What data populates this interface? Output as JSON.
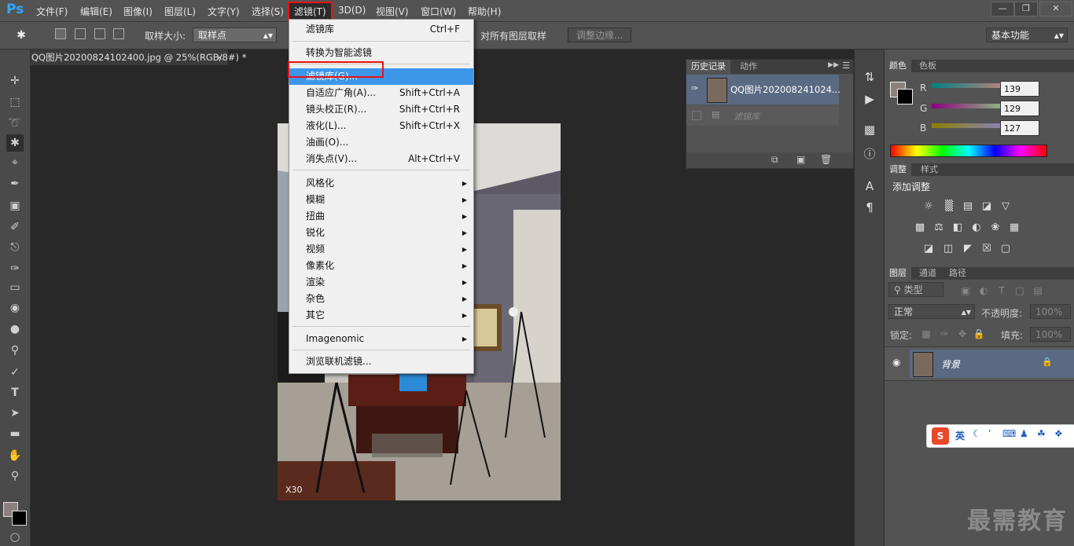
{
  "app": {
    "logo": "Ps"
  },
  "menubar": {
    "items": [
      "文件(F)",
      "编辑(E)",
      "图像(I)",
      "图层(L)",
      "文字(Y)",
      "选择(S)",
      "滤镜(T)",
      "3D(D)",
      "视图(V)",
      "窗口(W)",
      "帮助(H)"
    ]
  },
  "options": {
    "sample_size_label": "取样大小:",
    "sample_size_value": "取样点",
    "all_layers_label": "对所有图层取样",
    "refine_edge_label": "调整边缘...",
    "workspace_value": "基本功能"
  },
  "document": {
    "tab_title": "QQ图片20200824102400.jpg @ 25%(RGB/8#) *",
    "photo_caption": "X30"
  },
  "filter_menu": {
    "items": [
      {
        "label": "滤镜库",
        "shortcut": "Ctrl+F"
      },
      {
        "label": "转换为智能滤镜"
      },
      {
        "label": "滤镜库(G)..."
      },
      {
        "label": "自适应广角(A)...",
        "shortcut": "Shift+Ctrl+A"
      },
      {
        "label": "镜头校正(R)...",
        "shortcut": "Shift+Ctrl+R"
      },
      {
        "label": "液化(L)...",
        "shortcut": "Shift+Ctrl+X"
      },
      {
        "label": "油画(O)..."
      },
      {
        "label": "消失点(V)...",
        "shortcut": "Alt+Ctrl+V"
      },
      {
        "label": "风格化"
      },
      {
        "label": "模糊"
      },
      {
        "label": "扭曲"
      },
      {
        "label": "锐化"
      },
      {
        "label": "视频"
      },
      {
        "label": "像素化"
      },
      {
        "label": "渲染"
      },
      {
        "label": "杂色"
      },
      {
        "label": "其它"
      },
      {
        "label": "Imagenomic"
      },
      {
        "label": "浏览联机滤镜..."
      }
    ]
  },
  "history_panel": {
    "tabs": [
      "历史记录",
      "动作"
    ],
    "snapshot_label": "QQ图片202008241024...",
    "step_label": "滤镜库"
  },
  "color_panel": {
    "tabs": [
      "颜色",
      "色板"
    ],
    "r_label": "R",
    "g_label": "G",
    "b_label": "B",
    "r": "139",
    "g": "129",
    "b": "127",
    "foreground_color": "#8b817f"
  },
  "adjust_panel": {
    "tabs": [
      "调整",
      "样式"
    ],
    "title": "添加调整"
  },
  "layers_panel": {
    "tabs": [
      "图层",
      "通道",
      "路径"
    ],
    "filter_kind": "类型",
    "blend_mode": "正常",
    "opacity_label": "不透明度:",
    "opacity_value": "100%",
    "lock_label": "锁定:",
    "fill_label": "填充:",
    "fill_value": "100%",
    "layer_name": "背景"
  },
  "ime_bar": {
    "mode": "英"
  },
  "watermark": "最需教育"
}
